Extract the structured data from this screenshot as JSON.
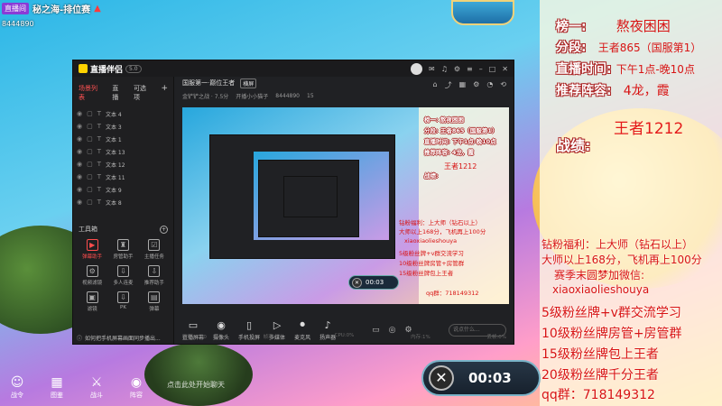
{
  "overlay": {
    "live_badge": "直播间",
    "stream_title": "秘之海-排位赛",
    "viewer_count": "8444890",
    "bottom_caption": "点击此处开始聊天"
  },
  "info_panel": {
    "rank_label": "榜一:",
    "rank_value": "熬夜困困",
    "tier_label": "分段:",
    "tier_value": "王者865（国服第1）",
    "time_label": "直播时间:",
    "time_value": "下午1点-晚10点",
    "lineup_label": "推荐阵容:",
    "lineup_value": "4龙，霞",
    "king_value": "王者1212",
    "record_label": "战绩:",
    "lines": [
      "钻粉福利：上大师（钻石以上）",
      "大师以上168分，飞机再上100分",
      "赛季末圆梦加微信:",
      "xiaoxiaolieshouya",
      "5级粉丝牌+v群交流学习",
      "10级粉丝牌房管+房管群",
      "15级粉丝牌包上王者",
      "20级粉丝牌千分王者",
      "qq群：718149312"
    ]
  },
  "timer": {
    "value": "00:03"
  },
  "bottom_left_icons": [
    {
      "glyph": "☺",
      "label": "战令",
      "icon": "smile-icon"
    },
    {
      "glyph": "▦",
      "label": "图鉴",
      "icon": "book-icon"
    },
    {
      "glyph": "⚔",
      "label": "战斗",
      "icon": "sword-icon"
    },
    {
      "glyph": "◉",
      "label": "阵容",
      "icon": "lineup-icon"
    }
  ],
  "app": {
    "name": "直播伴侣",
    "version": "5.0",
    "side_tabs": [
      "场景列表",
      "直播",
      "可选项"
    ],
    "scenes": [
      "文本 4",
      "文本 3",
      "文本 1",
      "文本 13",
      "文本 12",
      "文本 11",
      "文本 9",
      "文本 8"
    ],
    "tools_title": "工具箱",
    "tools": [
      {
        "glyph": "▶",
        "label": "弹幕助手",
        "icon": "danmaku-icon",
        "red": true
      },
      {
        "glyph": "♜",
        "label": "房管助手",
        "icon": "admin-icon",
        "red": false
      },
      {
        "glyph": "☑",
        "label": "主播任务",
        "icon": "task-icon",
        "red": false
      },
      {
        "glyph": "⚙",
        "label": "视频滤镜",
        "icon": "filter-icon",
        "red": false
      },
      {
        "glyph": "⇩",
        "label": "多人连麦",
        "icon": "multi-icon",
        "red": false
      },
      {
        "glyph": "⇩",
        "label": "推荐助手",
        "icon": "recommend-icon",
        "red": false
      },
      {
        "glyph": "▣",
        "label": "滤镜",
        "icon": "effect-icon",
        "red": false
      },
      {
        "glyph": "⇩",
        "label": "PK",
        "icon": "pk-icon",
        "red": false
      },
      {
        "glyph": "▤",
        "label": "弹幕",
        "icon": "bullet-icon",
        "red": false
      }
    ],
    "footer_text": "如何把手机屏幕画面同步播出...",
    "main_title": "国服第一·巅位王者",
    "main_tag": "横屏",
    "info_items": [
      "金铲铲之战 · 7.5分",
      "开播小小猫子",
      "8444890",
      "15"
    ],
    "bottom_tools": [
      {
        "glyph": "▭",
        "label": "直播屏幕",
        "icon": "screen-icon"
      },
      {
        "glyph": "◉",
        "label": "摄像头",
        "icon": "camera-icon"
      },
      {
        "glyph": "▯",
        "label": "手机投屏",
        "icon": "phone-icon"
      },
      {
        "glyph": "▷",
        "label": "多媒体",
        "icon": "media-icon"
      },
      {
        "glyph": "⏺",
        "label": "麦克风",
        "icon": "mic-icon"
      },
      {
        "glyph": "♪",
        "label": "扬声器",
        "icon": "speaker-icon"
      }
    ],
    "chat_placeholder": "说点什么...",
    "status": [
      "码率:3000",
      "帧率:0",
      "CPU:0%",
      "内存:1%",
      "丢帧:0%"
    ],
    "nested": {
      "rank": "榜一: 熬夜困困",
      "tier": "分段: 王者865（国服第1）",
      "time": "直播时间: 下午1点-晚10点",
      "lineup": "推荐阵容: 4龙，霞",
      "king": "王者1212",
      "record": "战绩:",
      "lines": [
        "钻粉福利：上大师（钻石以上）",
        "大师以上168分，飞机再上100分",
        "xiaoxiaolieshouya",
        "5级粉丝牌+v群交流学习",
        "10级粉丝牌房管+房管群",
        "15级粉丝牌包上王者",
        "qq群：718149312"
      ],
      "timer": "00:03"
    }
  },
  "colors": {
    "accent_red": "#d81414",
    "app_bg": "#202124",
    "panel_bg": "#fffae1"
  }
}
